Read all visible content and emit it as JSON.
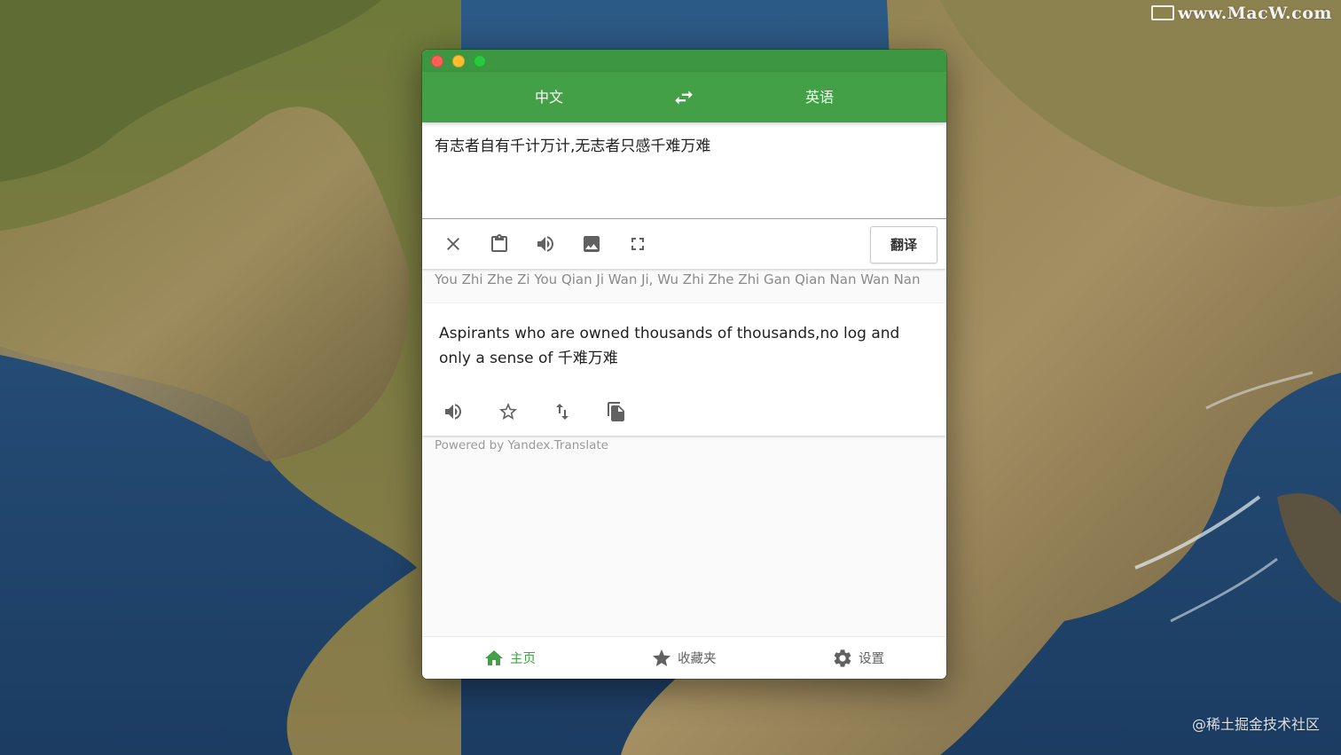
{
  "desktop": {
    "watermark_top": "www.MacW.com",
    "watermark_bottom": "@稀土掘金技术社区"
  },
  "window": {
    "language_bar": {
      "source_language": "中文",
      "target_language": "英语",
      "swap_icon": "swap-horiz-icon"
    },
    "input": {
      "text": "有志者自有千计万计,无志者只感千难万难",
      "toolbar": {
        "icons": [
          "clear-icon",
          "clipboard-icon",
          "speaker-icon",
          "image-icon",
          "fullscreen-icon"
        ],
        "translate_label": "翻译"
      }
    },
    "transliteration": "You Zhi Zhe Zi You Qian Ji Wan Ji, Wu Zhi Zhe Zhi Gan Qian Nan Wan Nan",
    "output": {
      "text": "Aspirants who are owned thousands of thousands,no log and only a sense of 千难万难",
      "icons": [
        "speaker-icon",
        "star-outline-icon",
        "swap-vert-icon",
        "copy-icon"
      ]
    },
    "powered_by": "Powered by Yandex.Translate",
    "bottom_nav": {
      "items": [
        {
          "label": "主页",
          "icon": "home-icon",
          "active": true
        },
        {
          "label": "收藏夹",
          "icon": "star-icon",
          "active": false
        },
        {
          "label": "设置",
          "icon": "gear-icon",
          "active": false
        }
      ]
    }
  },
  "colors": {
    "accent": "#43a047",
    "titlebar": "#3d9641"
  }
}
